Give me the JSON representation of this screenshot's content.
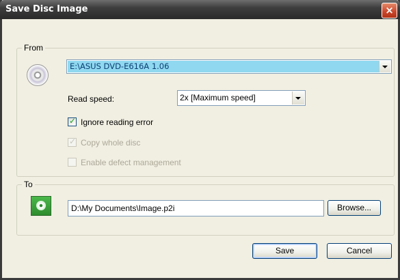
{
  "window": {
    "title": "Save Disc Image",
    "close_glyph": "×"
  },
  "from": {
    "legend": "From",
    "drive_icon": "cd-icon",
    "drive_value": "E:\\ASUS DVD-E616A 1.06",
    "read_speed_label": "Read speed:",
    "read_speed_value": "2x [Maximum speed]",
    "ignore_errors_label": "Ignore reading error",
    "ignore_errors_checked": true,
    "copy_whole_label": "Copy whole disc",
    "copy_whole_checked": true,
    "copy_whole_enabled": false,
    "defect_mgmt_label": "Enable defect management",
    "defect_mgmt_checked": false,
    "defect_mgmt_enabled": false
  },
  "to": {
    "legend": "To",
    "target_icon": "save-image-icon",
    "path_value": "D:\\My Documents\\Image.p2i",
    "browse_label": "Browse..."
  },
  "buttons": {
    "save_label": "Save",
    "cancel_label": "Cancel"
  },
  "colors": {
    "titlebar": "#3e3e3e",
    "dialog_bg": "#f1efe2",
    "selection": "#8fd8f0",
    "checkmark": "#21a121",
    "close": "#c8452a"
  }
}
